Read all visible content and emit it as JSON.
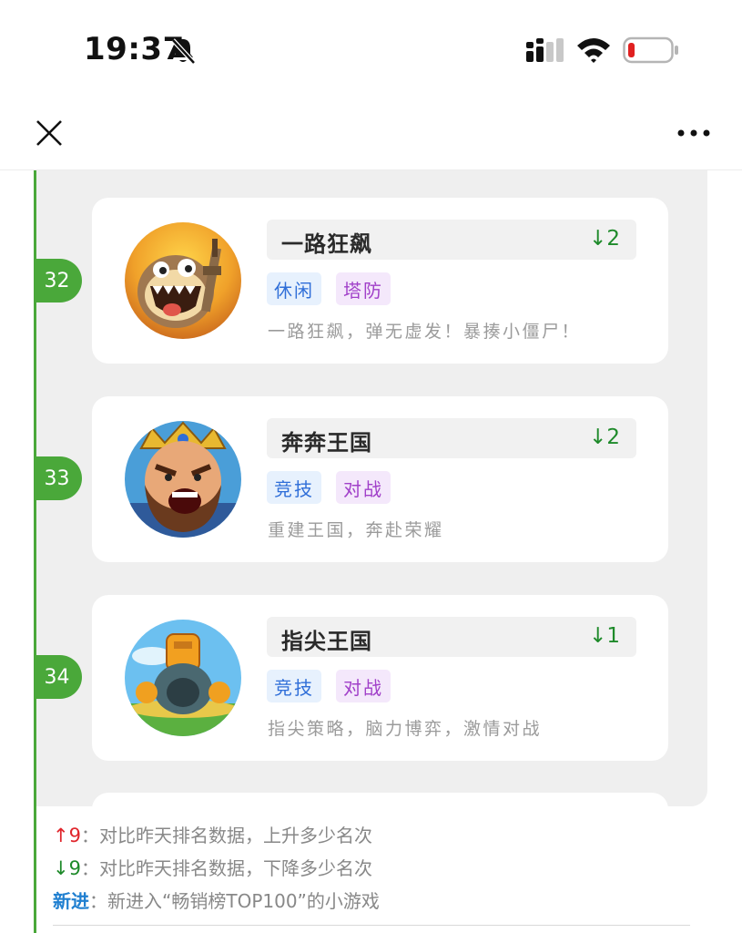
{
  "status_bar": {
    "time": "19:37",
    "battery_color": "#e02020"
  },
  "nav": {
    "close_icon": "close-icon",
    "more_icon": "more-icon"
  },
  "games": [
    {
      "rank": "32",
      "name": "一路狂飙",
      "change": "↓2",
      "tags": [
        "休闲",
        "塔防"
      ],
      "desc": "一路狂飙，弹无虚发！暴揍小僵尸！"
    },
    {
      "rank": "33",
      "name": "奔奔王国",
      "change": "↓2",
      "tags": [
        "竞技",
        "对战"
      ],
      "desc": "重建王国，奔赴荣耀"
    },
    {
      "rank": "34",
      "name": "指尖王国",
      "change": "↓1",
      "tags": [
        "竞技",
        "对战"
      ],
      "desc": "指尖策略，脑力博弈，激情对战"
    }
  ],
  "legend": {
    "up_symbol": "↑9",
    "up_text": "：对比昨天排名数据，上升多少名次",
    "down_symbol": "↓9",
    "down_text": "：对比昨天排名数据，下降多少名次",
    "new_label": "新进",
    "new_text": "：新进入“畅销榜TOP100”的小游戏"
  },
  "colors": {
    "accent_green": "#4aa83a",
    "down_green": "#1e8a2a",
    "up_red": "#e0262c",
    "tag_blue": "#2f6ed8",
    "tag_purple": "#a140c9",
    "new_blue": "#1f7fd0"
  }
}
